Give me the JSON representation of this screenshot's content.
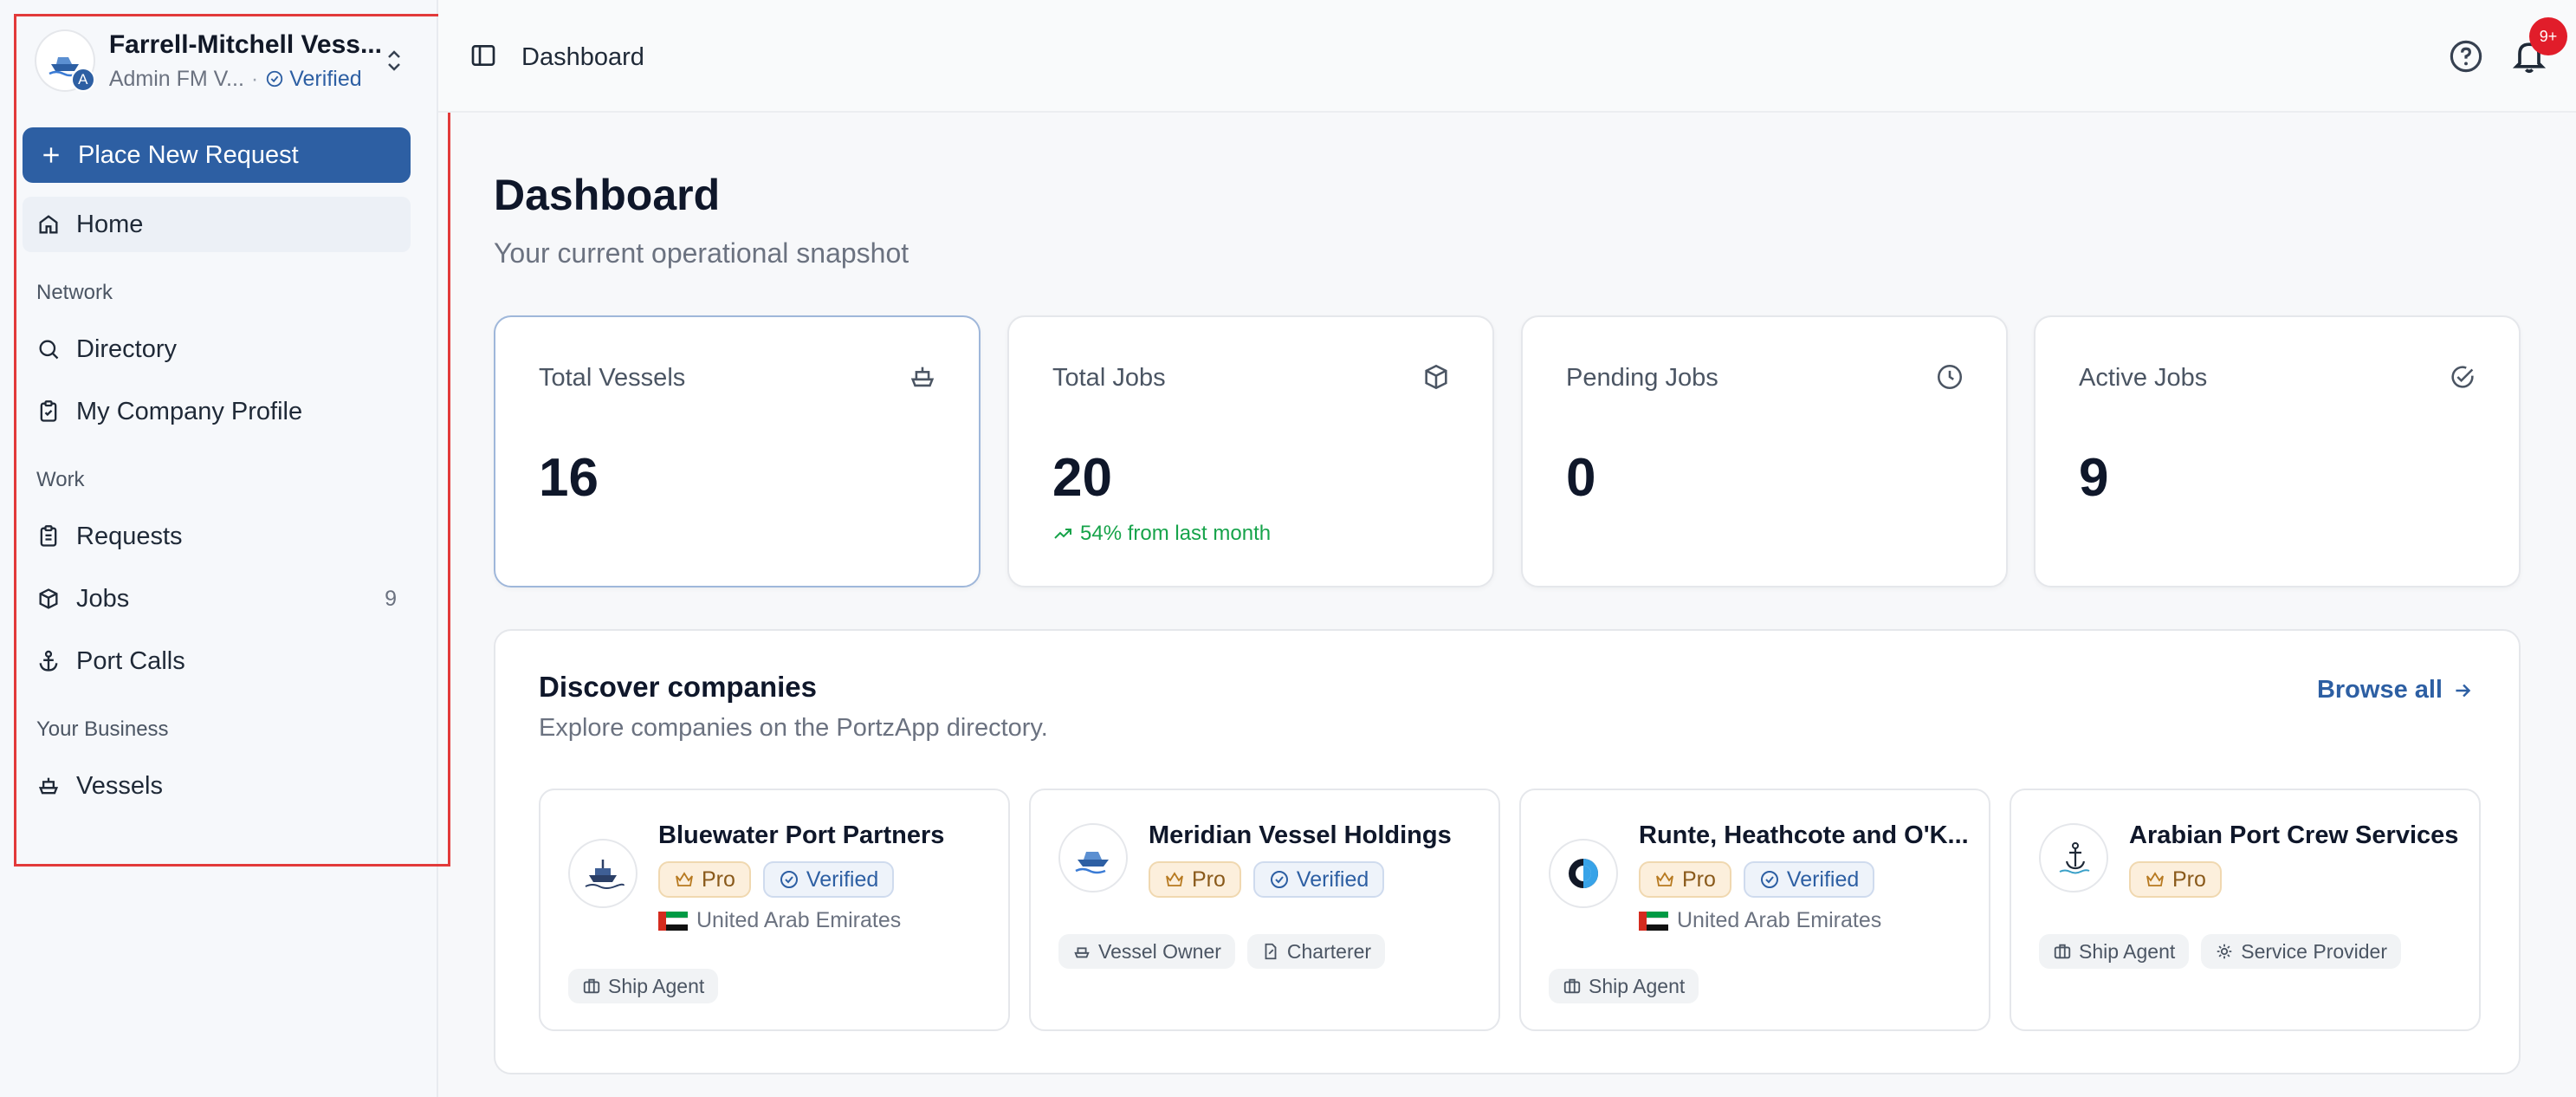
{
  "colors": {
    "primary": "#2d5fa3",
    "success": "#16a34a",
    "danger": "#e11d2a",
    "highlight": "#e23a3a"
  },
  "sidebar": {
    "org_name": "Farrell-Mitchell Vess...",
    "org_role": "Admin FM V...",
    "org_avatar_initial": "A",
    "verified_label": "Verified",
    "primary_action": "Place New Request",
    "home": "Home",
    "sections": {
      "network": "Network",
      "work": "Work",
      "business": "Your Business"
    },
    "items": {
      "directory": "Directory",
      "company_profile": "My Company Profile",
      "requests": "Requests",
      "jobs": "Jobs",
      "jobs_count": "9",
      "port_calls": "Port Calls",
      "vessels": "Vessels"
    }
  },
  "topbar": {
    "breadcrumb": "Dashboard",
    "notifications_badge": "9+"
  },
  "main": {
    "title": "Dashboard",
    "subtitle": "Your current operational snapshot",
    "stats": [
      {
        "label": "Total Vessels",
        "value": "16",
        "icon": "ship-icon"
      },
      {
        "label": "Total Jobs",
        "value": "20",
        "icon": "package-icon",
        "trend": "54% from last month"
      },
      {
        "label": "Pending Jobs",
        "value": "0",
        "icon": "clock-icon"
      },
      {
        "label": "Active Jobs",
        "value": "9",
        "icon": "check-circle-icon"
      }
    ],
    "discover": {
      "title": "Discover companies",
      "subtitle": "Explore companies on the PortzApp directory.",
      "browse_label": "Browse all",
      "companies": [
        {
          "name": "Bluewater Port Partners",
          "pro": "Pro",
          "verified": "Verified",
          "country": "United Arab Emirates",
          "tags": [
            "Ship Agent"
          ]
        },
        {
          "name": "Meridian Vessel Holdings",
          "pro": "Pro",
          "verified": "Verified",
          "tags": [
            "Vessel Owner",
            "Charterer"
          ]
        },
        {
          "name": "Runte, Heathcote and O'K...",
          "pro": "Pro",
          "verified": "Verified",
          "country": "United Arab Emirates",
          "tags": [
            "Ship Agent"
          ]
        },
        {
          "name": "Arabian Port Crew Services",
          "pro": "Pro",
          "tags": [
            "Ship Agent",
            "Service Provider"
          ]
        }
      ]
    }
  }
}
